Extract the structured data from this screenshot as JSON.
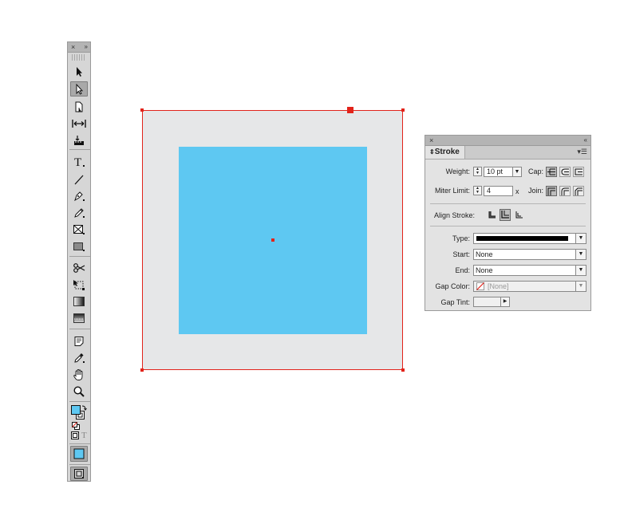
{
  "toolbox": {
    "close_label": "×",
    "collapse_label": "»",
    "tools": [
      {
        "name": "selection-tool-icon",
        "selected": false
      },
      {
        "name": "direct-selection-tool-icon",
        "selected": true
      },
      {
        "name": "page-tool-icon",
        "selected": false
      },
      {
        "name": "gap-tool-icon",
        "selected": false
      },
      {
        "name": "content-collector-tool-icon",
        "selected": false
      },
      {
        "name": "type-tool-icon",
        "selected": false
      },
      {
        "name": "line-tool-icon",
        "selected": false
      },
      {
        "name": "pen-tool-icon",
        "selected": false
      },
      {
        "name": "pencil-tool-icon",
        "selected": false
      },
      {
        "name": "rectangle-frame-tool-icon",
        "selected": false
      },
      {
        "name": "rectangle-tool-icon",
        "selected": false
      },
      {
        "name": "scissors-tool-icon",
        "selected": false
      },
      {
        "name": "free-transform-tool-icon",
        "selected": false
      },
      {
        "name": "gradient-swatch-tool-icon",
        "selected": false
      },
      {
        "name": "gradient-feather-tool-icon",
        "selected": false
      },
      {
        "name": "note-tool-icon",
        "selected": false
      },
      {
        "name": "eyedropper-tool-icon",
        "selected": false
      },
      {
        "name": "hand-tool-icon",
        "selected": false
      },
      {
        "name": "zoom-tool-icon",
        "selected": false
      }
    ],
    "fill_color": "#5ec8f2",
    "type_glyph": "T"
  },
  "canvas": {
    "outer_color": "#e6e7e8",
    "inner_color": "#5ec8f2",
    "selection_color": "#e2231a"
  },
  "stroke_panel": {
    "close_label": "×",
    "collapse_label": "«",
    "tab_label": "Stroke",
    "menu_label": "▾☰",
    "weight_label": "Weight:",
    "weight_value": "10 pt",
    "cap_label": "Cap:",
    "miter_label": "Miter Limit:",
    "miter_value": "4",
    "miter_unit": "x",
    "join_label": "Join:",
    "align_label": "Align Stroke:",
    "type_label": "Type:",
    "start_label": "Start:",
    "start_value": "None",
    "end_label": "End:",
    "end_value": "None",
    "gap_color_label": "Gap Color:",
    "gap_color_value": "[None]",
    "gap_tint_label": "Gap Tint:",
    "gap_tint_value": ""
  }
}
